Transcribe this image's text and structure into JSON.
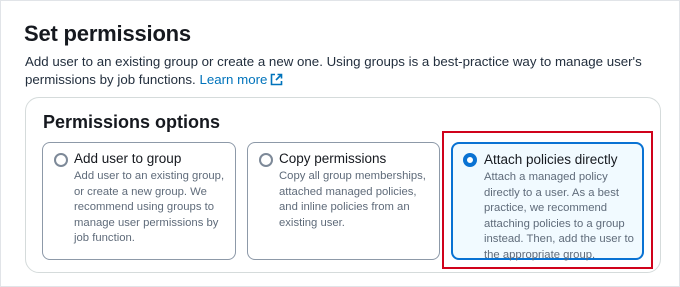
{
  "header": {
    "title": "Set permissions",
    "description": "Add user to an existing group or create a new one. Using groups is a best-practice way to manage user's permissions by job functions.",
    "learn_more": "Learn more",
    "external_icon": "external-link-icon"
  },
  "options": {
    "title": "Permissions options",
    "selected": "Attach policies directly",
    "items": [
      {
        "label": "Add user to group",
        "description": "Add user to an existing group, or create a new group. We recommend using groups to manage user permissions by job function.",
        "selected": false
      },
      {
        "label": "Copy permissions",
        "description": "Copy all group memberships, attached managed policies, and inline policies from an existing user.",
        "selected": false
      },
      {
        "label": "Attach policies directly",
        "description": "Attach a managed policy directly to a user. As a best practice, we recommend attaching policies to a group instead. Then, add the user to the appropriate group.",
        "selected": true
      }
    ]
  },
  "colors": {
    "accent": "#0972d3",
    "link": "#0073bb",
    "highlight": "#d0021b",
    "selected_bg": "#f1faff"
  }
}
